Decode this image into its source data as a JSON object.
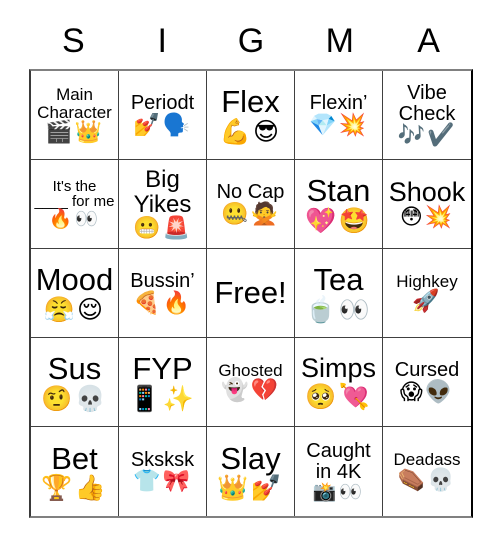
{
  "card": {
    "title_letters": [
      "S",
      "I",
      "G",
      "M",
      "A"
    ],
    "rows": 5,
    "columns": 5,
    "colors": {
      "background": "#ffffff",
      "text": "#000000",
      "grid_line": "#404040",
      "outer_border": "#000000"
    },
    "cells": [
      {
        "id": "r1c1",
        "text": "Main Character",
        "emoji": "🎬👑",
        "text_size": "t-sm",
        "emoji_size": "e-md"
      },
      {
        "id": "r1c2",
        "text": "Periodt",
        "emoji": "💅🗣️",
        "text_size": "t-md",
        "emoji_size": "e-md"
      },
      {
        "id": "r1c3",
        "text": "Flex",
        "emoji": "💪😎",
        "text_size": "t-xxl",
        "emoji_size": "e-lg"
      },
      {
        "id": "r1c4",
        "text": "Flexin’",
        "emoji": "💎💥",
        "text_size": "t-md",
        "emoji_size": "e-md"
      },
      {
        "id": "r1c5",
        "text": "Vibe Check",
        "emoji": "🎶✔️",
        "text_size": "t-md",
        "emoji_size": "e-md"
      },
      {
        "id": "r2c1",
        "text": "It's the ____ for me",
        "emoji": "🔥👀",
        "text_size": "t-xs",
        "emoji_size": "e-sm"
      },
      {
        "id": "r2c2",
        "text": "Big Yikes",
        "emoji": "😬🚨",
        "text_size": "t-lg",
        "emoji_size": "e-md"
      },
      {
        "id": "r2c3",
        "text": "No Cap",
        "emoji": "🤐🙅",
        "text_size": "t-md",
        "emoji_size": "e-md"
      },
      {
        "id": "r2c4",
        "text": "Stan",
        "emoji": "💖🤩",
        "text_size": "t-xxl",
        "emoji_size": "e-lg"
      },
      {
        "id": "r2c5",
        "text": "Shook",
        "emoji": "😳💥",
        "text_size": "t-xl",
        "emoji_size": "e-md"
      },
      {
        "id": "r3c1",
        "text": "Mood",
        "emoji": "😤😌",
        "text_size": "t-xxl",
        "emoji_size": "e-lg"
      },
      {
        "id": "r3c2",
        "text": "Bussin’",
        "emoji": "🍕🔥",
        "text_size": "t-md",
        "emoji_size": "e-md"
      },
      {
        "id": "r3c3",
        "text": "Free!",
        "emoji": "",
        "text_size": "t-xxl",
        "emoji_size": "e-lg"
      },
      {
        "id": "r3c4",
        "text": "Tea",
        "emoji": "🍵👀",
        "text_size": "t-xxl",
        "emoji_size": "e-lg"
      },
      {
        "id": "r3c5",
        "text": "Highkey",
        "emoji": "🚀",
        "text_size": "t-sm",
        "emoji_size": "e-md"
      },
      {
        "id": "r4c1",
        "text": "Sus",
        "emoji": "🤨💀",
        "text_size": "t-xxl",
        "emoji_size": "e-lg"
      },
      {
        "id": "r4c2",
        "text": "FYP",
        "emoji": "📱✨",
        "text_size": "t-xxl",
        "emoji_size": "e-lg"
      },
      {
        "id": "r4c3",
        "text": "Ghosted",
        "emoji": "👻💔",
        "text_size": "t-sm",
        "emoji_size": "e-md"
      },
      {
        "id": "r4c4",
        "text": "Simps",
        "emoji": "🥺💘",
        "text_size": "t-xl",
        "emoji_size": "e-lg"
      },
      {
        "id": "r4c5",
        "text": "Cursed",
        "emoji": "😱👽",
        "text_size": "t-md",
        "emoji_size": "e-md"
      },
      {
        "id": "r5c1",
        "text": "Bet",
        "emoji": "🏆👍",
        "text_size": "t-xxl",
        "emoji_size": "e-lg"
      },
      {
        "id": "r5c2",
        "text": "Sksksk",
        "emoji": "👕🎀",
        "text_size": "t-md",
        "emoji_size": "e-md"
      },
      {
        "id": "r5c3",
        "text": "Slay",
        "emoji": "👑💅",
        "text_size": "t-xxl",
        "emoji_size": "e-lg"
      },
      {
        "id": "r5c4",
        "text": "Caught in 4K",
        "emoji": "📸👀",
        "text_size": "t-md",
        "emoji_size": "e-sm"
      },
      {
        "id": "r5c5",
        "text": "Deadass",
        "emoji": "⚰️💀",
        "text_size": "t-sm",
        "emoji_size": "e-md"
      }
    ]
  }
}
